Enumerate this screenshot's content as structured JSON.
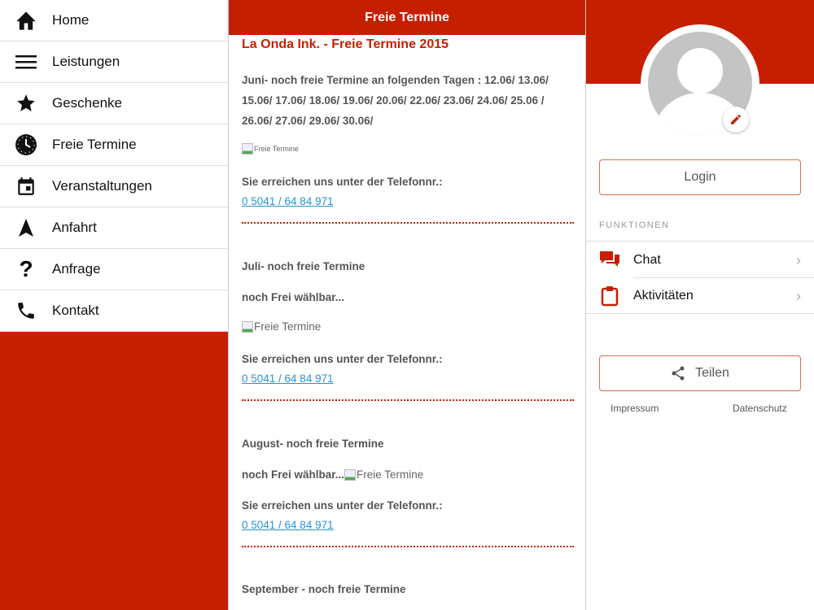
{
  "menu": [
    {
      "label": "Home",
      "icon": "home-icon"
    },
    {
      "label": "Leistungen",
      "icon": "menu-icon"
    },
    {
      "label": "Geschenke",
      "icon": "star-icon"
    },
    {
      "label": "Freie Termine",
      "icon": "clock-icon"
    },
    {
      "label": "Veranstaltungen",
      "icon": "calendar-icon"
    },
    {
      "label": "Anfahrt",
      "icon": "navigation-icon"
    },
    {
      "label": "Anfrage",
      "icon": "question-icon"
    },
    {
      "label": "Kontakt",
      "icon": "phone-icon"
    }
  ],
  "header": {
    "title": "Freie Termine"
  },
  "content": {
    "title": "La Onda Ink. - Freie Termine 2015",
    "juni": {
      "heading": "Juni- noch freie Termine an folgenden Tagen :  12.06/ 13.06/ 15.06/ 17.06/ 18.06/ 19.06/ 20.06/ 22.06/ 23.06/ 24.06/ 25.06 / 26.06/ 27.06/ 29.06/ 30.06/",
      "img_alt": "Freie Termine",
      "phone_label": "Sie erreichen uns unter der Telefonnr.:",
      "phone": "0 5041 / 64 84 971"
    },
    "juli": {
      "heading": "Juli- noch freie Termine",
      "text": "noch Frei wählbar...",
      "img_alt": "Freie Termine",
      "phone_label": "Sie erreichen uns unter der Telefonnr.:",
      "phone": "0 5041 / 64 84 971"
    },
    "august": {
      "heading": "August- noch freie Termine",
      "text": "noch Frei wählbar...",
      "img_alt": "Freie Termine",
      "phone_label": "Sie erreichen uns unter der Telefonnr.:",
      "phone": "0 5041 / 64 84 971"
    },
    "september": {
      "heading": "September - noch freie Termine"
    }
  },
  "sidebar": {
    "login": "Login",
    "section": "FUNKTIONEN",
    "items": [
      {
        "label": "Chat",
        "icon": "chat-icon"
      },
      {
        "label": "Aktivitäten",
        "icon": "clipboard-icon"
      }
    ],
    "share": "Teilen",
    "impressum": "Impressum",
    "datenschutz": "Datenschutz"
  },
  "colors": {
    "brand": "#c61f00",
    "link": "#2a93d5"
  }
}
